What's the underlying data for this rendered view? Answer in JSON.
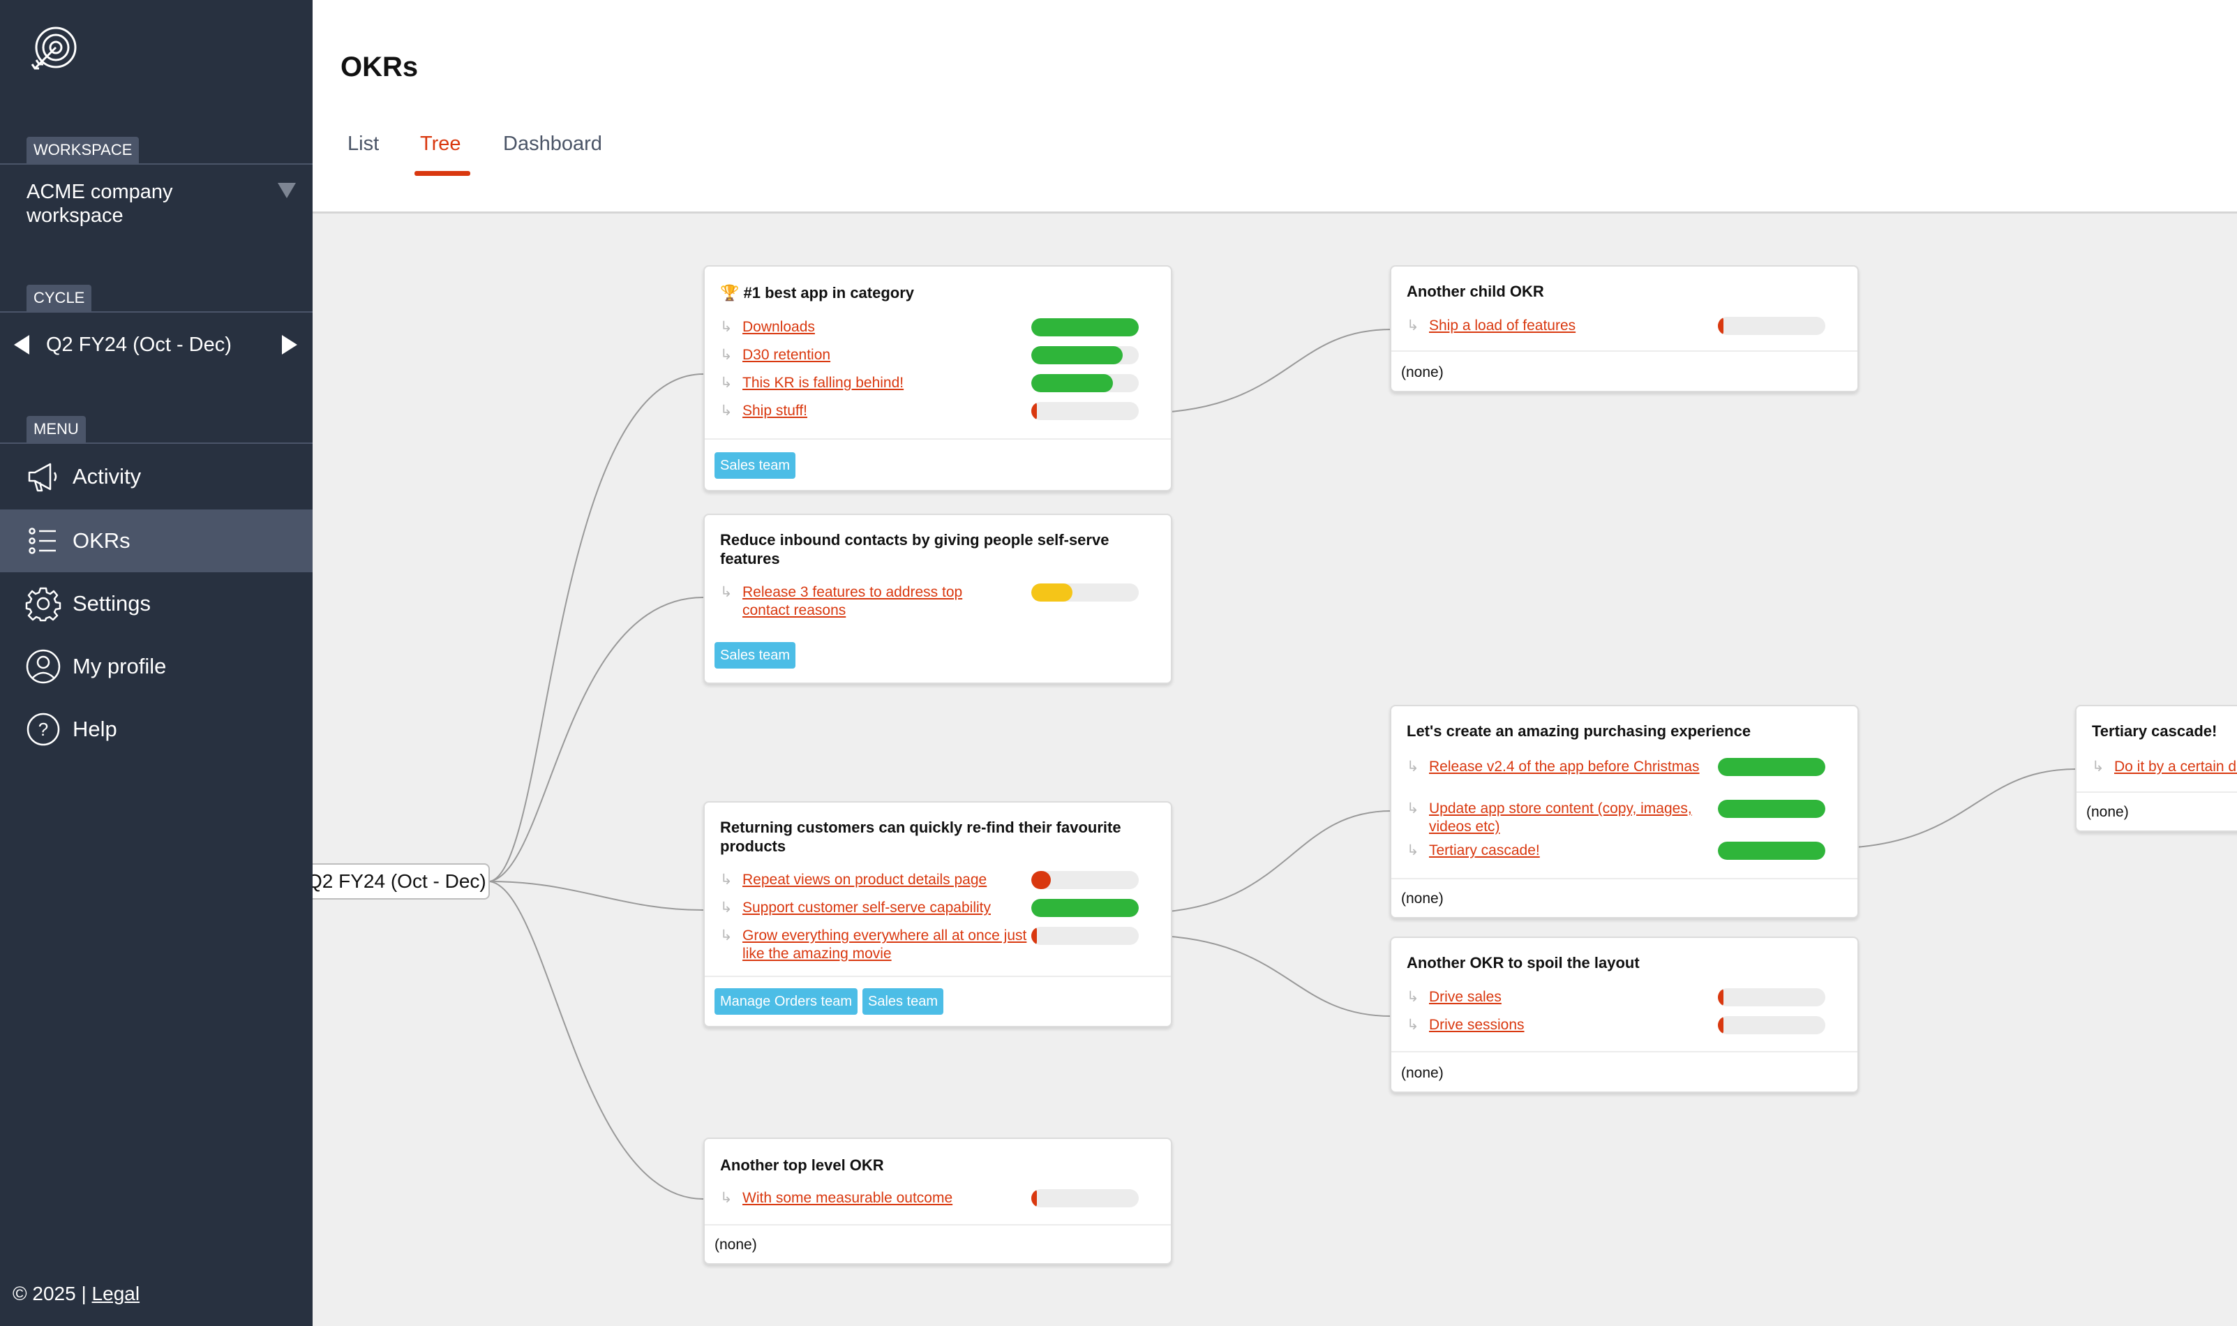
{
  "app": {
    "title": "OKRs"
  },
  "sidebar": {
    "workspace_label": "WORKSPACE",
    "workspace_name": "ACME company workspace",
    "cycle_label": "CYCLE",
    "cycle_name": "Q2 FY24 (Oct - Dec)",
    "menu_label": "MENU",
    "menu": [
      {
        "label": "Activity",
        "icon": "megaphone-icon"
      },
      {
        "label": "OKRs",
        "icon": "list-icon",
        "active": true
      },
      {
        "label": "Settings",
        "icon": "gear-icon"
      },
      {
        "label": "My profile",
        "icon": "user-icon"
      },
      {
        "label": "Help",
        "icon": "help-icon"
      }
    ],
    "footer_text": "© 2025 |",
    "footer_link": "Legal"
  },
  "tabs": [
    {
      "label": "List"
    },
    {
      "label": "Tree",
      "active": true
    },
    {
      "label": "Dashboard"
    }
  ],
  "tree": {
    "root_label": "Q2 FY24 (Oct - Dec)",
    "okrs": [
      {
        "title": "🏆 #1 best app in category",
        "krs": [
          {
            "label": "Downloads",
            "progress": 100,
            "color": "#2fb53a"
          },
          {
            "label": "D30 retention",
            "progress": 85,
            "color": "#2fb53a"
          },
          {
            "label": "This KR is falling behind!",
            "progress": 76,
            "color": "#2fb53a"
          },
          {
            "label": "Ship stuff!",
            "progress": 4,
            "color": "#d9380f"
          }
        ],
        "teams": [
          "Sales team"
        ]
      },
      {
        "title": "Reduce inbound contacts by giving people self-serve features",
        "krs": [
          {
            "label": "Release 3 features to address top contact reasons",
            "progress": 38,
            "color": "#f5c518"
          }
        ],
        "teams": [
          "Sales team"
        ]
      },
      {
        "title": "Returning customers can quickly re-find their favourite products",
        "krs": [
          {
            "label": "Repeat views on product details page",
            "progress": 18,
            "color": "#d9380f"
          },
          {
            "label": "Support customer self-serve capability",
            "progress": 100,
            "color": "#2fb53a"
          },
          {
            "label": "Grow everything everywhere all at once just like the amazing movie",
            "progress": 4,
            "color": "#d9380f"
          }
        ],
        "teams": [
          "Manage Orders team",
          "Sales team"
        ]
      },
      {
        "title": "Another top level OKR",
        "krs": [
          {
            "label": "With some measurable outcome",
            "progress": 4,
            "color": "#d9380f"
          }
        ],
        "teams_none": "(none)"
      },
      {
        "title": "Another child OKR",
        "krs": [
          {
            "label": "Ship a load of features",
            "progress": 4,
            "color": "#d9380f"
          }
        ],
        "teams_none": "(none)"
      },
      {
        "title": "Let's create an amazing purchasing experience",
        "krs": [
          {
            "label": "Release v2.4 of the app before Christmas",
            "progress": 100,
            "color": "#2fb53a"
          },
          {
            "label": "Update app store content (copy, images, videos etc)",
            "progress": 100,
            "color": "#2fb53a"
          },
          {
            "label": "Tertiary cascade!",
            "progress": 100,
            "color": "#2fb53a"
          }
        ],
        "teams_none": "(none)"
      },
      {
        "title": "Another OKR to spoil the layout",
        "krs": [
          {
            "label": "Drive sales",
            "progress": 4,
            "color": "#d9380f"
          },
          {
            "label": "Drive sessions",
            "progress": 4,
            "color": "#d9380f"
          }
        ],
        "teams_none": "(none)"
      },
      {
        "title": "Tertiary cascade!",
        "krs": [
          {
            "label": "Do it by a certain date"
          }
        ],
        "teams_none": "(none)"
      }
    ]
  }
}
